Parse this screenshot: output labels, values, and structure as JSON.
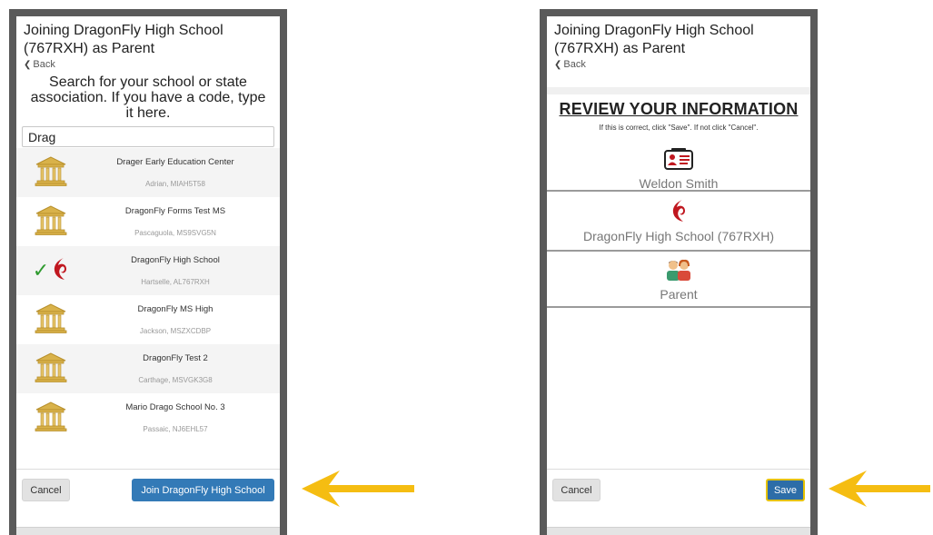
{
  "left_screen": {
    "header_title": "Joining DragonFly High School (767RXH) as Parent",
    "back_label": "Back",
    "search_heading": "Search for your school or state association. If you have a code, type it here.",
    "search_value": "Drag",
    "results": [
      {
        "name": "Drager Early Education Center",
        "location": "Adrian, MIAH5T58",
        "icon": "school-building-icon",
        "selected": false
      },
      {
        "name": "DragonFly Forms Test MS",
        "location": "Pascaguola, MS9SVG5N",
        "icon": "school-building-icon",
        "selected": false
      },
      {
        "name": "DragonFly High School",
        "location": "Hartselle, AL767RXH",
        "icon": "dragonfly-logo-icon",
        "selected": true
      },
      {
        "name": "DragonFly MS High",
        "location": "Jackson, MSZXCDBP",
        "icon": "school-building-icon",
        "selected": false
      },
      {
        "name": "DragonFly Test 2",
        "location": "Carthage, MSVGK3G8",
        "icon": "school-building-icon",
        "selected": false
      },
      {
        "name": "Mario Drago School No. 3",
        "location": "Passaic, NJ6EHL57",
        "icon": "school-building-icon",
        "selected": false
      }
    ],
    "cancel_label": "Cancel",
    "join_label": "Join DragonFly High School"
  },
  "right_screen": {
    "header_title": "Joining DragonFly High School (767RXH) as Parent",
    "back_label": "Back",
    "review_title": "REVIEW YOUR INFORMATION",
    "review_subtitle": "If this is correct, click \"Save\". If not click \"Cancel\".",
    "person_name": "Weldon Smith",
    "school_name": "DragonFly High School (767RXH)",
    "role": "Parent",
    "cancel_label": "Cancel",
    "save_label": "Save"
  },
  "colors": {
    "primary_button": "#337ab7",
    "arrow": "#f5bd12",
    "checkmark": "#2e9a2e",
    "logo_red": "#c0171f",
    "building": "#d9b24a"
  }
}
